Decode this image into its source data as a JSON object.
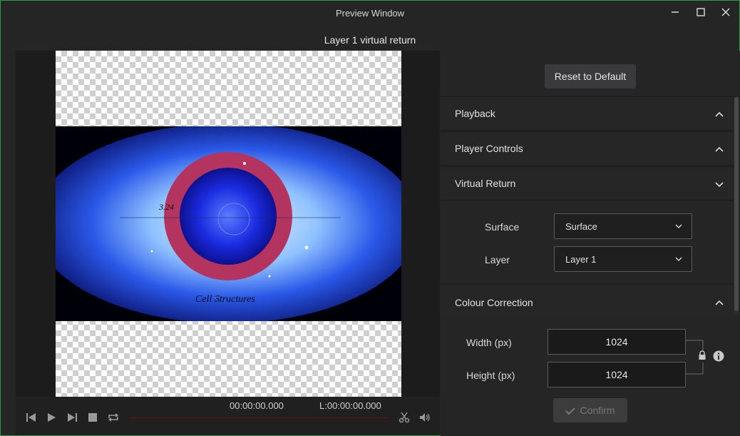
{
  "window": {
    "title": "Preview Window",
    "subtitle": "Layer 1 virtual return",
    "accent": "#2e9b45"
  },
  "titlebar_buttons": {
    "minimize": "minimize-icon",
    "maximize": "maximize-icon",
    "close": "close-icon"
  },
  "preview": {
    "video_caption": "Cell Structures",
    "video_overlay_text": "3.24"
  },
  "transport": {
    "current_time": "00:00:00.000",
    "length_time": "L:00:00:00.000",
    "progress": 0,
    "buttons": [
      "skip-back-icon",
      "play-icon",
      "skip-forward-icon",
      "stop-icon",
      "loop-icon",
      "scissors-icon",
      "volume-icon"
    ]
  },
  "panel": {
    "reset_label": "Reset to Default",
    "sections": {
      "playback": "Playback",
      "player_controls": "Player Controls",
      "virtual_return": "Virtual Return",
      "colour_correction": "Colour Correction"
    },
    "surface": {
      "label": "Surface",
      "value": "Surface"
    },
    "layer": {
      "label": "Layer",
      "value": "Layer 1"
    },
    "width": {
      "label": "Width (px)",
      "value": "1024"
    },
    "height": {
      "label": "Height (px)",
      "value": "1024"
    },
    "confirm_label": "Confirm"
  }
}
